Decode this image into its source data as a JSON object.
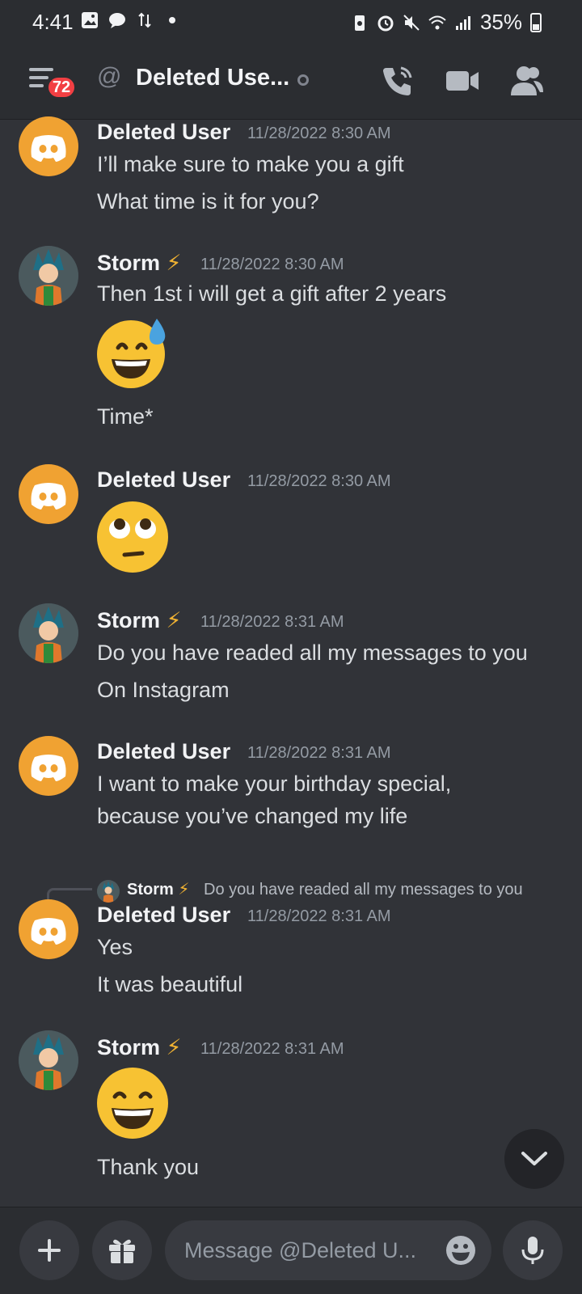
{
  "status_bar": {
    "time": "4:41",
    "battery": "35%"
  },
  "header": {
    "unread_count": "72",
    "title": "Deleted Use...",
    "at_symbol": "@"
  },
  "messages": [
    {
      "author": "Deleted User",
      "time": "11/28/2022 8:30 AM",
      "lines": [
        "I’ll make sure to make you a gift",
        "What time is it for you?"
      ]
    },
    {
      "author": "Storm",
      "badge": "⚡",
      "time": "11/28/2022 8:30 AM",
      "lines": [
        "Then 1st i will get a gift after 2 years",
        "Time*"
      ],
      "emoji": "grinning-face-with-sweat"
    },
    {
      "author": "Deleted User",
      "time": "11/28/2022 8:30 AM",
      "emoji": "face-with-rolling-eyes"
    },
    {
      "author": "Storm",
      "badge": "⚡",
      "time": "11/28/2022 8:31 AM",
      "lines": [
        "Do you have readed all my messages to you",
        "On Instagram"
      ]
    },
    {
      "author": "Deleted User",
      "time": "11/28/2022 8:31 AM",
      "lines": [
        "I want to make your birthday special,",
        "because you’ve changed my life"
      ]
    },
    {
      "author": "Deleted User",
      "time": "11/28/2022 8:31 AM",
      "lines": [
        "Yes",
        "It was beautiful"
      ],
      "reply_to": {
        "author": "Storm",
        "badge": "⚡",
        "text": "Do you have readed all my messages to you"
      }
    },
    {
      "author": "Storm",
      "badge": "⚡",
      "time": "11/28/2022 8:31 AM",
      "lines": [
        "Thank you"
      ],
      "emoji": "grinning-squinting-face"
    }
  ],
  "composer": {
    "placeholder": "Message @Deleted U..."
  },
  "icons": {
    "brand_accent": "#f0a232",
    "badge_red": "#f23f43"
  }
}
